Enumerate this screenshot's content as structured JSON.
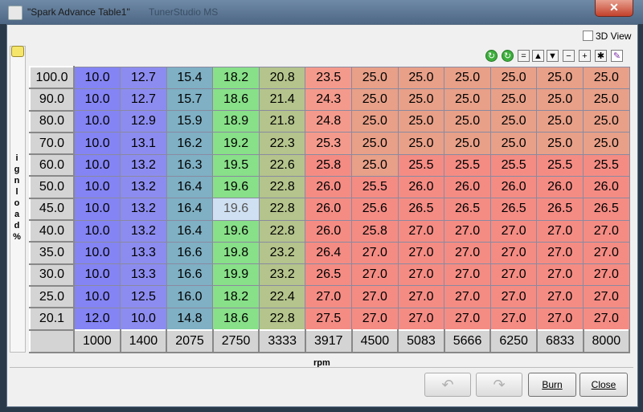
{
  "window": {
    "title": "\"Spark Advance Table1\"",
    "background_title": "TunerStudio MS",
    "close_glyph": "✕"
  },
  "view3d": {
    "label": "3D View",
    "checked": false
  },
  "toolbar": {
    "buttons": [
      {
        "name": "green-up-icon",
        "glyph": "↻"
      },
      {
        "name": "green-down-icon",
        "glyph": "↻"
      },
      {
        "name": "equals-button",
        "glyph": "="
      },
      {
        "name": "increase-button",
        "glyph": "▲"
      },
      {
        "name": "decrease-button",
        "glyph": "▼"
      },
      {
        "name": "minus-button",
        "glyph": "−"
      },
      {
        "name": "plus-button",
        "glyph": "+"
      },
      {
        "name": "multiply-button",
        "glyph": "✱"
      },
      {
        "name": "pen-icon",
        "glyph": "✎"
      }
    ]
  },
  "y_axis": {
    "label_chars": [
      "i",
      "g",
      "n",
      "l",
      "o",
      "a",
      "d",
      "",
      "%"
    ]
  },
  "x_axis": {
    "label": "rpm"
  },
  "table": {
    "rows": [
      "100.0",
      "90.0",
      "80.0",
      "70.0",
      "60.0",
      "50.0",
      "45.0",
      "40.0",
      "35.0",
      "30.0",
      "25.0",
      "20.1"
    ],
    "cols": [
      "1000",
      "1400",
      "2075",
      "2750",
      "3333",
      "3917",
      "4500",
      "5083",
      "5666",
      "6250",
      "6833",
      "8000"
    ],
    "values": [
      [
        "10.0",
        "12.7",
        "15.4",
        "18.2",
        "20.8",
        "23.5",
        "25.0",
        "25.0",
        "25.0",
        "25.0",
        "25.0",
        "25.0"
      ],
      [
        "10.0",
        "12.7",
        "15.7",
        "18.6",
        "21.4",
        "24.3",
        "25.0",
        "25.0",
        "25.0",
        "25.0",
        "25.0",
        "25.0"
      ],
      [
        "10.0",
        "12.9",
        "15.9",
        "18.9",
        "21.8",
        "24.8",
        "25.0",
        "25.0",
        "25.0",
        "25.0",
        "25.0",
        "25.0"
      ],
      [
        "10.0",
        "13.1",
        "16.2",
        "19.2",
        "22.3",
        "25.3",
        "25.0",
        "25.0",
        "25.0",
        "25.0",
        "25.0",
        "25.0"
      ],
      [
        "10.0",
        "13.2",
        "16.3",
        "19.5",
        "22.6",
        "25.8",
        "25.0",
        "25.5",
        "25.5",
        "25.5",
        "25.5",
        "25.5"
      ],
      [
        "10.0",
        "13.2",
        "16.4",
        "19.6",
        "22.8",
        "26.0",
        "25.5",
        "26.0",
        "26.0",
        "26.0",
        "26.0",
        "26.0"
      ],
      [
        "10.0",
        "13.2",
        "16.4",
        "19.6",
        "22.8",
        "26.0",
        "25.6",
        "26.5",
        "26.5",
        "26.5",
        "26.5",
        "26.5"
      ],
      [
        "10.0",
        "13.2",
        "16.4",
        "19.6",
        "22.8",
        "26.0",
        "25.8",
        "27.0",
        "27.0",
        "27.0",
        "27.0",
        "27.0"
      ],
      [
        "10.0",
        "13.3",
        "16.6",
        "19.8",
        "23.2",
        "26.4",
        "27.0",
        "27.0",
        "27.0",
        "27.0",
        "27.0",
        "27.0"
      ],
      [
        "10.0",
        "13.3",
        "16.6",
        "19.9",
        "23.2",
        "26.5",
        "27.0",
        "27.0",
        "27.0",
        "27.0",
        "27.0",
        "27.0"
      ],
      [
        "10.0",
        "12.5",
        "16.0",
        "18.2",
        "22.4",
        "27.0",
        "27.0",
        "27.0",
        "27.0",
        "27.0",
        "27.0",
        "27.0"
      ],
      [
        "12.0",
        "10.0",
        "14.8",
        "18.6",
        "22.8",
        "27.5",
        "27.0",
        "27.0",
        "27.0",
        "27.0",
        "27.0",
        "27.0"
      ]
    ],
    "selected": {
      "row": 6,
      "col": 3
    }
  },
  "colors": {
    "cols": [
      "#8484f4",
      "#8c8cf0",
      "#7fb0c4",
      "#88e088",
      "#b4c48c",
      "#f49a8c",
      "#e8a088",
      "#e8a088",
      "#e8a088",
      "#e8a088",
      "#e8a088",
      "#e8a088"
    ],
    "hot": "#f48c84"
  },
  "buttons": {
    "undo_glyph": "↶",
    "redo_glyph": "↷",
    "burn": "Burn",
    "close": "Close"
  }
}
